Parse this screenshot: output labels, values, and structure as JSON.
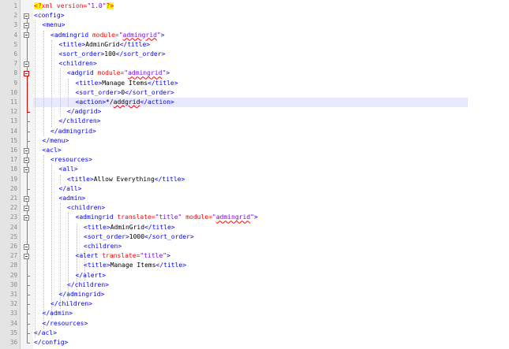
{
  "editor": {
    "lines": [
      {
        "number": "1",
        "segments": [
          {
            "t": "<?",
            "c": "decl"
          },
          {
            "t": "xml version=",
            "c": "attr"
          },
          {
            "t": "\"1.0\"",
            "c": "val"
          },
          {
            "t": "?>",
            "c": "decl"
          }
        ]
      },
      {
        "number": "2",
        "segments": [
          {
            "t": "<config>",
            "c": "tag"
          }
        ]
      },
      {
        "number": "3",
        "segments": [
          {
            "t": "<menu>",
            "c": "tag"
          }
        ]
      },
      {
        "number": "4",
        "segments": [
          {
            "t": "<admingrid ",
            "c": "tag"
          },
          {
            "t": "module=",
            "c": "attr"
          },
          {
            "t": "\"",
            "c": "val"
          },
          {
            "t": "admingrid",
            "c": "val sq"
          },
          {
            "t": "\"",
            "c": "val"
          },
          {
            "t": ">",
            "c": "tag"
          }
        ]
      },
      {
        "number": "5",
        "segments": [
          {
            "t": "<title>",
            "c": "tag"
          },
          {
            "t": "AdminGrid",
            "c": "txt"
          },
          {
            "t": "</title>",
            "c": "tag"
          }
        ]
      },
      {
        "number": "6",
        "segments": [
          {
            "t": "<sort_order>",
            "c": "tag"
          },
          {
            "t": "100",
            "c": "txt"
          },
          {
            "t": "</sort_order>",
            "c": "tag"
          }
        ]
      },
      {
        "number": "7",
        "segments": [
          {
            "t": "<children>",
            "c": "tag"
          }
        ]
      },
      {
        "number": "8",
        "segments": [
          {
            "t": "<adgrid ",
            "c": "tag"
          },
          {
            "t": "module=",
            "c": "attr"
          },
          {
            "t": "\"",
            "c": "val"
          },
          {
            "t": "admingrid",
            "c": "val sq"
          },
          {
            "t": "\"",
            "c": "val"
          },
          {
            "t": ">",
            "c": "tag"
          }
        ]
      },
      {
        "number": "9",
        "segments": [
          {
            "t": "<title>",
            "c": "tag"
          },
          {
            "t": "Manage Items",
            "c": "txt"
          },
          {
            "t": "</title>",
            "c": "tag"
          }
        ]
      },
      {
        "number": "10",
        "segments": [
          {
            "t": "<sort_order>",
            "c": "tag"
          },
          {
            "t": "0",
            "c": "txt"
          },
          {
            "t": "</sort_order>",
            "c": "tag"
          }
        ]
      },
      {
        "number": "11",
        "segments": [
          {
            "t": "<action>",
            "c": "tag"
          },
          {
            "t": "*/",
            "c": "txt"
          },
          {
            "t": "addgrid",
            "c": "txt sq"
          },
          {
            "t": "</action>",
            "c": "tag"
          }
        ]
      },
      {
        "number": "12",
        "segments": [
          {
            "t": "</adgrid>",
            "c": "tag"
          }
        ]
      },
      {
        "number": "13",
        "segments": [
          {
            "t": "</children>",
            "c": "tag"
          }
        ]
      },
      {
        "number": "14",
        "segments": [
          {
            "t": "</admingrid>",
            "c": "tag"
          }
        ]
      },
      {
        "number": "15",
        "segments": [
          {
            "t": "</menu>",
            "c": "tag"
          }
        ]
      },
      {
        "number": "16",
        "segments": [
          {
            "t": "<acl>",
            "c": "tag"
          }
        ]
      },
      {
        "number": "17",
        "segments": [
          {
            "t": "<resources>",
            "c": "tag"
          }
        ]
      },
      {
        "number": "18",
        "segments": [
          {
            "t": "<all>",
            "c": "tag"
          }
        ]
      },
      {
        "number": "19",
        "segments": [
          {
            "t": "<title>",
            "c": "tag"
          },
          {
            "t": "Allow Everything",
            "c": "txt"
          },
          {
            "t": "</title>",
            "c": "tag"
          }
        ]
      },
      {
        "number": "20",
        "segments": [
          {
            "t": "</all>",
            "c": "tag"
          }
        ]
      },
      {
        "number": "21",
        "segments": [
          {
            "t": "<admin>",
            "c": "tag"
          }
        ]
      },
      {
        "number": "22",
        "segments": [
          {
            "t": "<children>",
            "c": "tag"
          }
        ]
      },
      {
        "number": "23",
        "segments": [
          {
            "t": "<admingrid ",
            "c": "tag"
          },
          {
            "t": "translate=",
            "c": "attr"
          },
          {
            "t": "\"title\" ",
            "c": "val"
          },
          {
            "t": "module=",
            "c": "attr"
          },
          {
            "t": "\"",
            "c": "val"
          },
          {
            "t": "admingrid",
            "c": "val sq"
          },
          {
            "t": "\"",
            "c": "val"
          },
          {
            "t": ">",
            "c": "tag"
          }
        ]
      },
      {
        "number": "24",
        "segments": [
          {
            "t": "<title>",
            "c": "tag"
          },
          {
            "t": "AdminGrid",
            "c": "txt"
          },
          {
            "t": "</title>",
            "c": "tag"
          }
        ]
      },
      {
        "number": "25",
        "segments": [
          {
            "t": "<sort_order>",
            "c": "tag"
          },
          {
            "t": "1000",
            "c": "txt"
          },
          {
            "t": "</sort_order>",
            "c": "tag"
          }
        ]
      },
      {
        "number": "26",
        "segments": [
          {
            "t": "<children>",
            "c": "tag"
          }
        ]
      },
      {
        "number": "27",
        "segments": [
          {
            "t": "<alert ",
            "c": "tag"
          },
          {
            "t": "translate=",
            "c": "attr"
          },
          {
            "t": "\"title\"",
            "c": "val"
          },
          {
            "t": ">",
            "c": "tag"
          }
        ]
      },
      {
        "number": "28",
        "segments": [
          {
            "t": "<title>",
            "c": "tag"
          },
          {
            "t": "Manage Items",
            "c": "txt"
          },
          {
            "t": "</title>",
            "c": "tag"
          }
        ]
      },
      {
        "number": "29",
        "segments": [
          {
            "t": "</alert>",
            "c": "tag"
          }
        ]
      },
      {
        "number": "30",
        "segments": [
          {
            "t": "</children>",
            "c": "tag"
          }
        ]
      },
      {
        "number": "31",
        "segments": [
          {
            "t": "</admingrid>",
            "c": "tag"
          }
        ]
      },
      {
        "number": "32",
        "segments": [
          {
            "t": "</children>",
            "c": "tag"
          }
        ]
      },
      {
        "number": "33",
        "segments": [
          {
            "t": "</admin>",
            "c": "tag"
          }
        ]
      },
      {
        "number": "34",
        "segments": [
          {
            "t": "</resources>",
            "c": "tag"
          }
        ]
      },
      {
        "number": "35",
        "segments": [
          {
            "t": "</acl>",
            "c": "tag"
          }
        ]
      },
      {
        "number": "36",
        "segments": [
          {
            "t": "</config>",
            "c": "tag"
          }
        ]
      }
    ],
    "current_line": "11",
    "colors": {
      "tag": "#0000ff",
      "attribute": "#ff0000",
      "attribute_value": "#8000ff",
      "text": "#000000",
      "xml_declaration_bg": "#ffff00",
      "current_line_bg": "#e8e8ff",
      "gutter_bg": "#e4e4e4",
      "fold_active": "#d80000"
    }
  }
}
